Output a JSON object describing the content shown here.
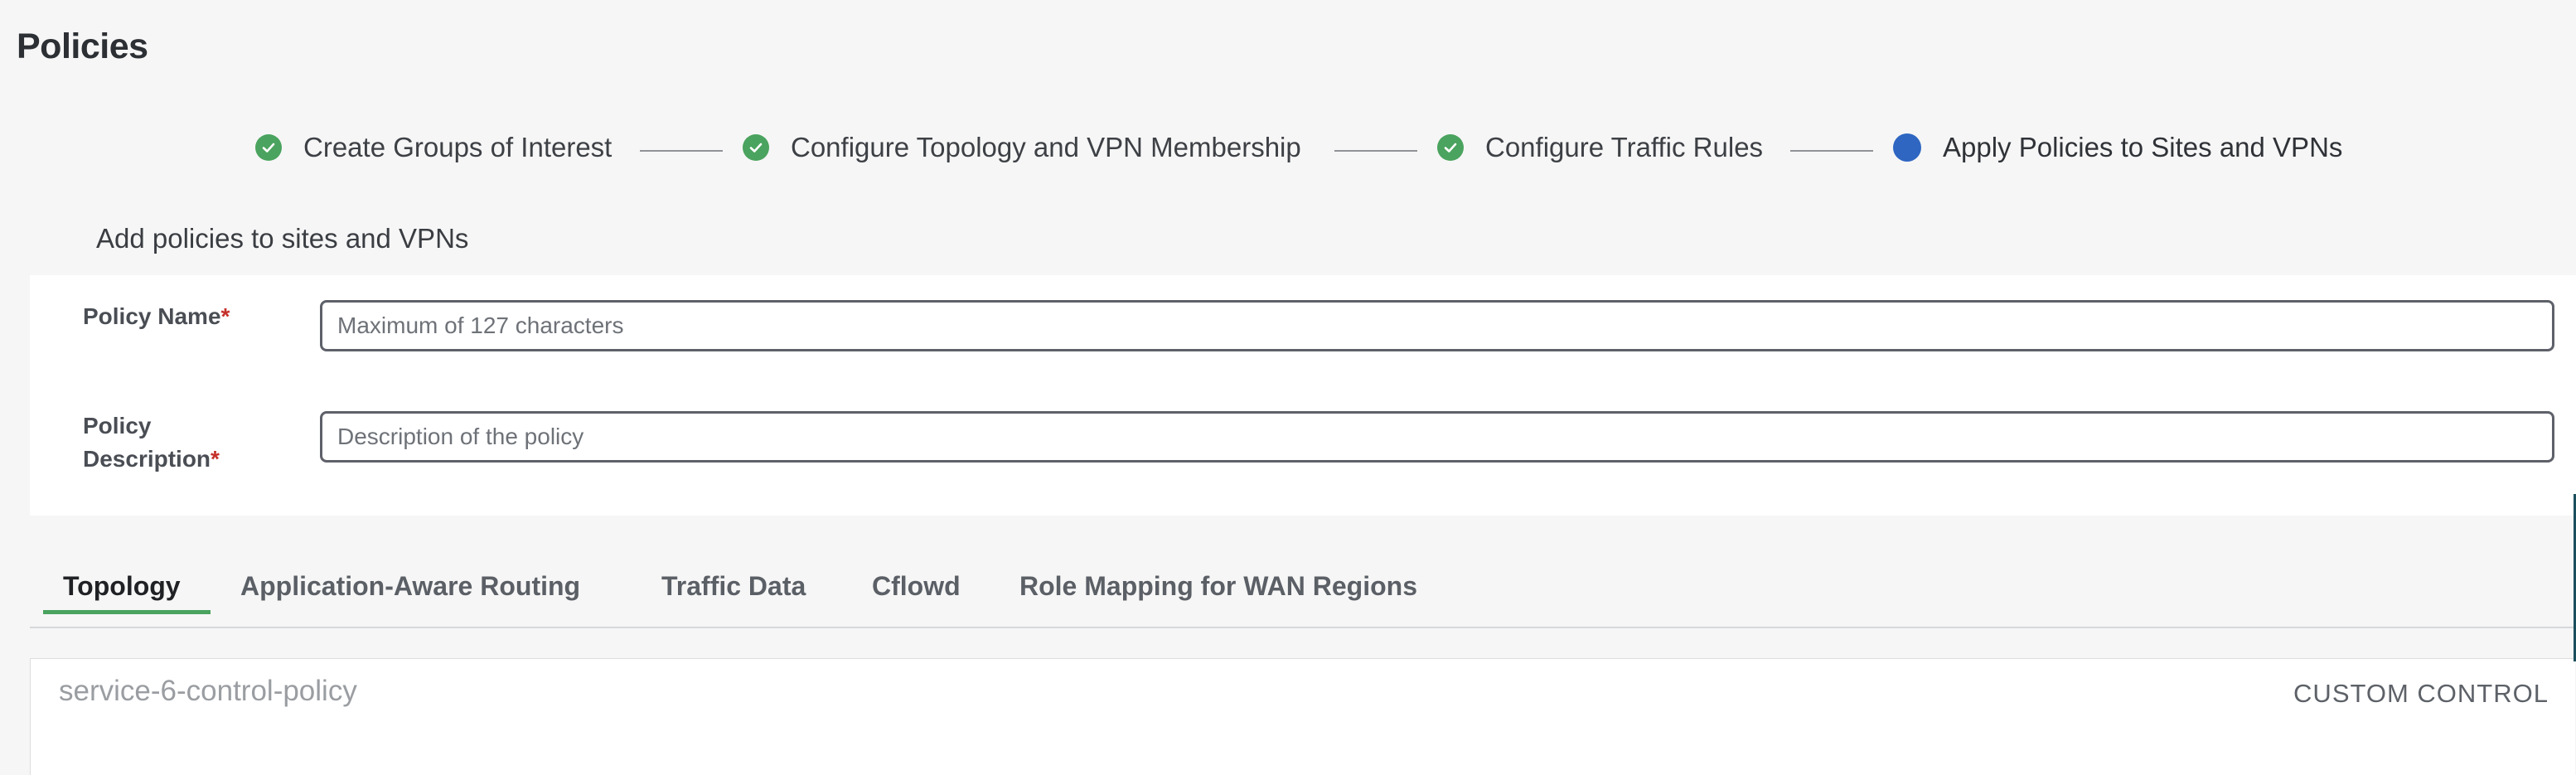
{
  "page": {
    "title": "Policies"
  },
  "wizard": {
    "steps": [
      {
        "label": "Create Groups of Interest",
        "state": "completed",
        "icon": "check-icon"
      },
      {
        "label": "Configure Topology and VPN Membership",
        "state": "completed",
        "icon": "check-icon"
      },
      {
        "label": "Configure Traffic Rules",
        "state": "completed",
        "icon": "check-icon"
      },
      {
        "label": "Apply Policies to Sites and VPNs",
        "state": "current",
        "icon": "dot-icon"
      }
    ],
    "completed_color": "#4aa35e",
    "current_color": "#2e66c2"
  },
  "section": {
    "heading": "Add policies to sites and VPNs"
  },
  "form": {
    "policy_name": {
      "label": "Policy Name",
      "required_mark": "*",
      "value": "",
      "placeholder": "Maximum of 127 characters"
    },
    "policy_description": {
      "label_line1": "Policy",
      "label_line2": "Description",
      "required_mark": "*",
      "value": "",
      "placeholder": "Description of the policy"
    }
  },
  "tabs": {
    "items": [
      {
        "label": "Topology",
        "active": true
      },
      {
        "label": "Application-Aware Routing",
        "active": false
      },
      {
        "label": "Traffic Data",
        "active": false
      },
      {
        "label": "Cflowd",
        "active": false
      },
      {
        "label": "Role Mapping for WAN Regions",
        "active": false
      }
    ],
    "active_color": "#4aa35e"
  },
  "policy_list": {
    "items": [
      {
        "name": "service-6-control-policy",
        "type": "CUSTOM CONTROL"
      }
    ]
  }
}
